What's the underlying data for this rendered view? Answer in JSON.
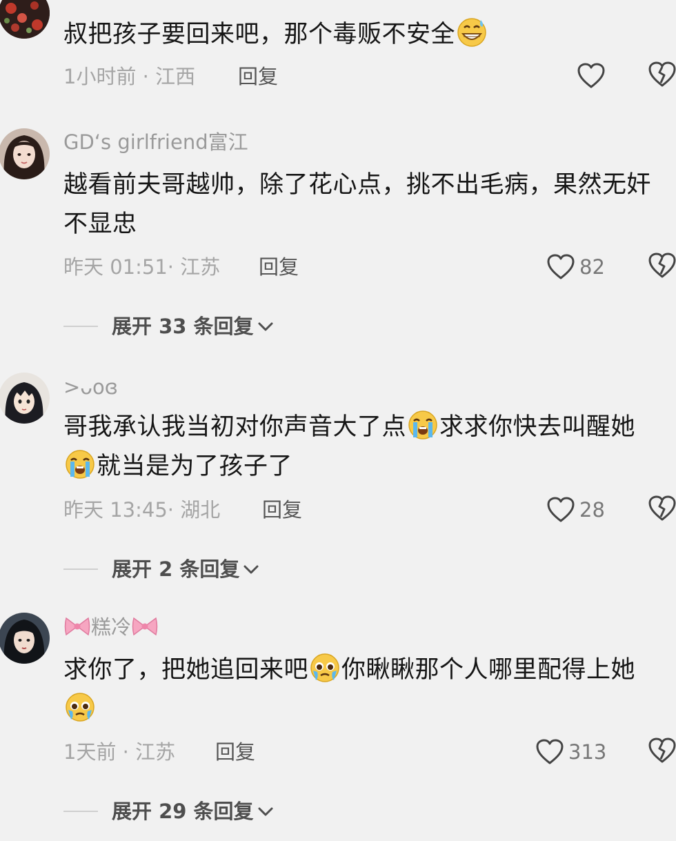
{
  "comments": [
    {
      "username": "",
      "text": "叔把孩子要回来吧，那个毒贩不安全",
      "text_emoji": "grinning-sweat-emoji",
      "meta": "1小时前 · 江西",
      "reply_label": "回复",
      "likes": ""
    },
    {
      "username": "GD‘s girlfriend富江",
      "text": "越看前夫哥越帅，除了花心点，挑不出毛病，果然无奸不显忠",
      "meta": "昨天 01:51· 江苏",
      "reply_label": "回复",
      "likes": "82",
      "expand_label": "展开 33 条回复"
    },
    {
      "username": ">ᴗoɞ",
      "text_part1": "哥我承认我当初对你声音大了点",
      "text_part2": "求求你快去叫醒她",
      "text_part3": "就当是为了孩子了",
      "meta": "昨天 13:45· 湖北",
      "reply_label": "回复",
      "likes": "28",
      "expand_label": "展开 2 条回复"
    },
    {
      "username": "糕冷",
      "text_part1": "求你了，把她追回来吧",
      "text_part2": "你瞅瞅那个人哪里配得上她",
      "meta": "1天前 · 江苏",
      "reply_label": "回复",
      "likes": "313",
      "expand_label": "展开 29 条回复"
    }
  ],
  "colors": {
    "background": "#f1f1f1",
    "text": "#161616",
    "meta": "#a5a5a5",
    "username": "#9a9a9a",
    "icon": "#444444"
  }
}
